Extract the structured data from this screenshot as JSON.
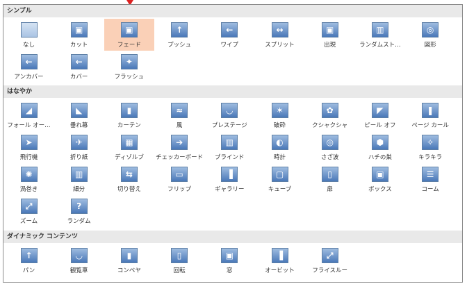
{
  "sections": [
    {
      "title": "シンプル",
      "items": [
        {
          "label": "なし",
          "icon": "none-icon",
          "glyph": ""
        },
        {
          "label": "カット",
          "icon": "cut-icon",
          "glyph": "▣"
        },
        {
          "label": "フェード",
          "icon": "fade-icon",
          "glyph": "▣",
          "selected": true
        },
        {
          "label": "プッシュ",
          "icon": "push-icon",
          "glyph": "↑"
        },
        {
          "label": "ワイプ",
          "icon": "wipe-icon",
          "glyph": "←"
        },
        {
          "label": "スプリット",
          "icon": "split-icon",
          "glyph": "↔"
        },
        {
          "label": "出現",
          "icon": "reveal-icon",
          "glyph": "▣"
        },
        {
          "label": "ランダムスト…",
          "icon": "random-bars-icon",
          "glyph": "▥"
        },
        {
          "label": "図形",
          "icon": "shape-icon",
          "glyph": "◎"
        },
        {
          "label": "アンカバー",
          "icon": "uncover-icon",
          "glyph": "←"
        },
        {
          "label": "カバー",
          "icon": "cover-icon",
          "glyph": "←"
        },
        {
          "label": "フラッシュ",
          "icon": "flash-icon",
          "glyph": "✦"
        }
      ]
    },
    {
      "title": "はなやか",
      "items": [
        {
          "label": "フォール オー…",
          "icon": "fall-over-icon",
          "glyph": "◢"
        },
        {
          "label": "垂れ幕",
          "icon": "drape-icon",
          "glyph": "◣"
        },
        {
          "label": "カーテン",
          "icon": "curtains-icon",
          "glyph": "▮"
        },
        {
          "label": "風",
          "icon": "wind-icon",
          "glyph": "≈"
        },
        {
          "label": "プレステージ",
          "icon": "prestige-icon",
          "glyph": "◡"
        },
        {
          "label": "破砕",
          "icon": "fracture-icon",
          "glyph": "✶"
        },
        {
          "label": "クシャクシャ",
          "icon": "crush-icon",
          "glyph": "✿"
        },
        {
          "label": "ピール オフ",
          "icon": "peel-off-icon",
          "glyph": "◤"
        },
        {
          "label": "ページ カール",
          "icon": "page-curl-icon",
          "glyph": "❚"
        },
        {
          "label": "飛行機",
          "icon": "airplane-icon",
          "glyph": "➤"
        },
        {
          "label": "折り紙",
          "icon": "origami-icon",
          "glyph": "✈"
        },
        {
          "label": "ディゾルブ",
          "icon": "dissolve-icon",
          "glyph": "▦"
        },
        {
          "label": "チェッカーボード",
          "icon": "checkerboard-icon",
          "glyph": "➔"
        },
        {
          "label": "ブラインド",
          "icon": "blinds-icon",
          "glyph": "▥"
        },
        {
          "label": "時計",
          "icon": "clock-icon",
          "glyph": "◐"
        },
        {
          "label": "さざ波",
          "icon": "ripple-icon",
          "glyph": "◎"
        },
        {
          "label": "ハチの巣",
          "icon": "honeycomb-icon",
          "glyph": "⬢"
        },
        {
          "label": "キラキラ",
          "icon": "glitter-icon",
          "glyph": "✧"
        },
        {
          "label": "渦巻き",
          "icon": "vortex-icon",
          "glyph": "✺"
        },
        {
          "label": "細分",
          "icon": "shred-icon",
          "glyph": "▥"
        },
        {
          "label": "切り替え",
          "icon": "switch-icon",
          "glyph": "⇆"
        },
        {
          "label": "フリップ",
          "icon": "flip-icon",
          "glyph": "▭"
        },
        {
          "label": "ギャラリー",
          "icon": "gallery-icon",
          "glyph": "▐"
        },
        {
          "label": "キューブ",
          "icon": "cube-icon",
          "glyph": "▢"
        },
        {
          "label": "扉",
          "icon": "doors-icon",
          "glyph": "▯"
        },
        {
          "label": "ボックス",
          "icon": "box-icon",
          "glyph": "▣"
        },
        {
          "label": "コーム",
          "icon": "comb-icon",
          "glyph": "☰"
        },
        {
          "label": "ズーム",
          "icon": "zoom-icon",
          "glyph": "⤢"
        },
        {
          "label": "ランダム",
          "icon": "random-icon",
          "glyph": "?"
        }
      ]
    },
    {
      "title": "ダイナミック コンテンツ",
      "items": [
        {
          "label": "パン",
          "icon": "pan-icon",
          "glyph": "↑"
        },
        {
          "label": "観覧車",
          "icon": "ferris-wheel-icon",
          "glyph": "◡"
        },
        {
          "label": "コンベヤ",
          "icon": "conveyor-icon",
          "glyph": "▮"
        },
        {
          "label": "回転",
          "icon": "rotate-icon",
          "glyph": "▯"
        },
        {
          "label": "窓",
          "icon": "window-icon",
          "glyph": "▣"
        },
        {
          "label": "オービット",
          "icon": "orbit-icon",
          "glyph": "▐"
        },
        {
          "label": "フライスルー",
          "icon": "fly-through-icon",
          "glyph": "⤢"
        }
      ]
    }
  ]
}
